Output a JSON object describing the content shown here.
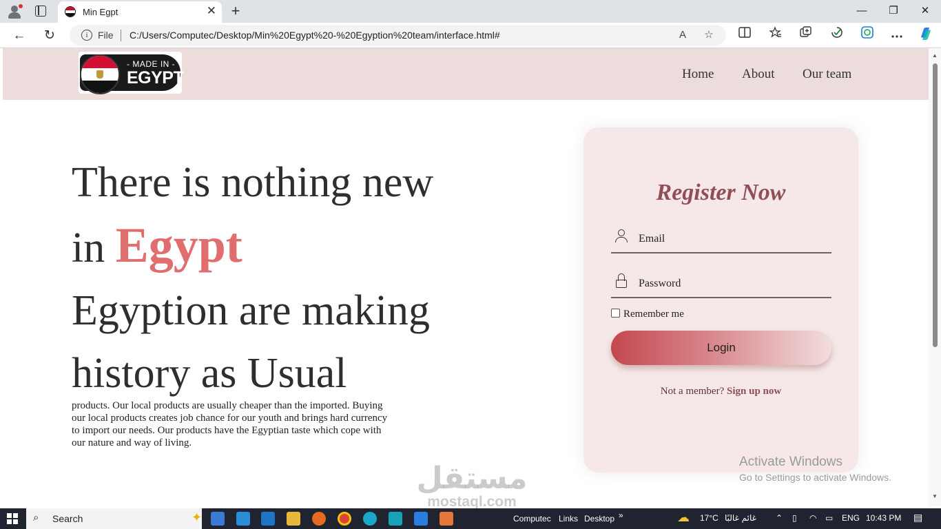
{
  "browser": {
    "tab_title": "Min Egpt",
    "tab_close": "✕",
    "new_tab": "+",
    "win_minimize": "—",
    "win_restore": "❐",
    "win_close": "✕",
    "back": "←",
    "reload": "↻",
    "info": "i",
    "file_label": "File",
    "url": "C:/Users/Computec/Desktop/Min%20Egypt%20-%20Egyption%20team/interface.html#",
    "read_aloud": "A",
    "favorite": "☆"
  },
  "header": {
    "logo_top": "- MADE IN -",
    "logo_main": "EGYPT",
    "nav": [
      "Home",
      "About",
      "Our team"
    ]
  },
  "hero": {
    "line1": "There is nothing new",
    "line2_prefix": "in ",
    "line2_accent": "Egypt",
    "line3": "Egyption are making",
    "line4": "history as Usual",
    "paragraph": "products. Our local products are usually cheaper than the imported. Buying our local products creates job chance for our youth and brings hard currency to import our needs. Our products have the Egyptian taste which cope with our nature and way of living."
  },
  "register": {
    "title": "Register Now",
    "email_label": "Email",
    "password_label": "Password",
    "remember_label": "Remember me",
    "login_label": "Login",
    "signup_prefix": "Not a member?",
    "signup_link": "Sign up now"
  },
  "overlay": {
    "activate_title": "Activate Windows",
    "activate_sub": "Go to Settings to activate Windows.",
    "watermark_ar": "مستقل",
    "watermark_en": "mostaql.com"
  },
  "taskbar": {
    "search_label": "Search",
    "toolbar_items": [
      "Computec",
      "Links",
      "Desktop"
    ],
    "chevron": "»",
    "temperature": "17°C",
    "weather": "غائم غالبًا",
    "language": "ENG",
    "time": "10:43 PM"
  },
  "colors": {
    "header_bg": "#ecdcdc",
    "accent": "#e06e6e",
    "card_bg": "#f6e8e8",
    "title_color": "#8e4f55"
  }
}
